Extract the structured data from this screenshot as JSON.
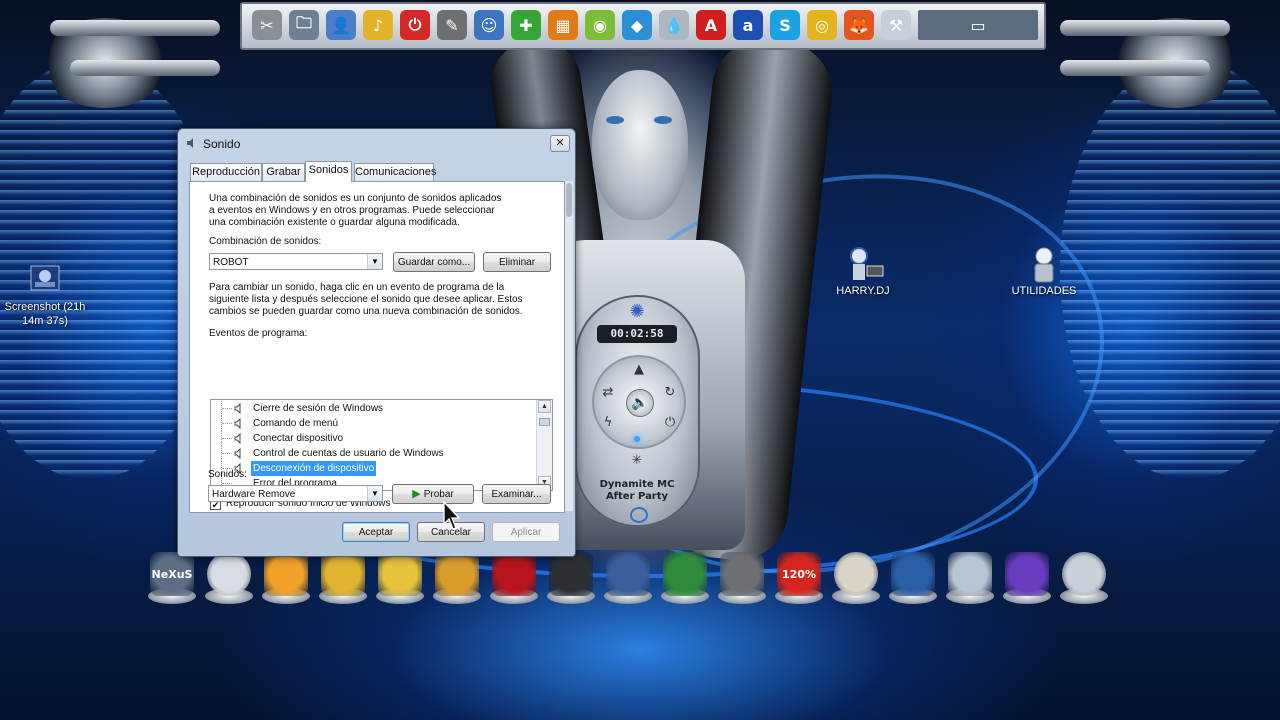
{
  "colors": {
    "selection": "#3399ff",
    "dialog_frame": "#b6c7dd",
    "wallpaper_blue": "#0f5fc9"
  },
  "desktop": {
    "icons": [
      {
        "label": "Screenshot (21h 14m 37s)",
        "icon": "image-file-icon"
      },
      {
        "label": "HARRY.DJ",
        "icon": "robot-dj-icon"
      },
      {
        "label": "UTILIDADES",
        "icon": "robot-utilities-icon"
      }
    ]
  },
  "top_dock": {
    "icons": [
      "tools-icon",
      "folder-tools-icon",
      "user-computer-icon",
      "music-note-icon",
      "power-icon",
      "pen-tool-icon",
      "user-icon",
      "support-icon",
      "paint-icon",
      "android-icon",
      "bluestacks-icon",
      "droplet-icon",
      "pdf-icon",
      "amazon-icon",
      "skype-icon",
      "chrome-icon",
      "firefox-icon",
      "network-icon",
      "window-thumbnails-icon"
    ]
  },
  "bottom_dock": {
    "label": "NeXuS",
    "zoom_label": "120%",
    "icons": [
      "nexus-icon",
      "clock-icon",
      "mail-icon",
      "folder-icon",
      "folder-icon-2",
      "folder-icon-3",
      "record-icon",
      "webcam-icon",
      "satellite-icon",
      "color-icon",
      "film-icon",
      "adobe-icon",
      "burn-icon",
      "virtualbox-icon",
      "computer-icon",
      "media-icon",
      "eye-icon"
    ]
  },
  "player": {
    "time": "00:02:58",
    "name_line1": "Dynamite MC",
    "name_line2": "After Party"
  },
  "dialog": {
    "title": "Sonido",
    "close": "✕",
    "tabs": [
      "Reproducción",
      "Grabar",
      "Sonidos",
      "Comunicaciones"
    ],
    "active_tab": "Sonidos",
    "intro_lines": [
      "Una combinación de sonidos es un conjunto de sonidos aplicados",
      "a eventos en Windows y en otros programas. Puede seleccionar",
      "una combinación existente o guardar alguna modificada."
    ],
    "scheme_label": "Combinación de sonidos:",
    "scheme_value": "ROBOT",
    "save_as": "Guardar como...",
    "delete": "Eliminar",
    "change_lines": [
      "Para cambiar un sonido, haga clic en un evento de programa de la",
      "siguiente lista y después seleccione el sonido que desee aplicar. Estos",
      "cambios se pueden guardar como una nueva combinación de sonidos."
    ],
    "events_label": "Eventos de programa:",
    "events": [
      {
        "label": "Cierre de sesión de Windows",
        "icon": true
      },
      {
        "label": "Comando de menú",
        "icon": true
      },
      {
        "label": "Conectar dispositivo",
        "icon": true
      },
      {
        "label": "Control de cuentas de usuario de Windows",
        "icon": true
      },
      {
        "label": "Desconexión de dispositivo",
        "icon": true,
        "selected": true
      },
      {
        "label": "Error del programa",
        "icon": false
      }
    ],
    "play_startup_label": "Reproducir sonido Inicio de Windows",
    "play_startup_checked": true,
    "sounds_label": "Sonidos:",
    "sound_value": "Hardware Remove",
    "test": "Probar",
    "browse": "Examinar...",
    "ok": "Aceptar",
    "cancel": "Cancelar",
    "apply": "Aplicar"
  }
}
